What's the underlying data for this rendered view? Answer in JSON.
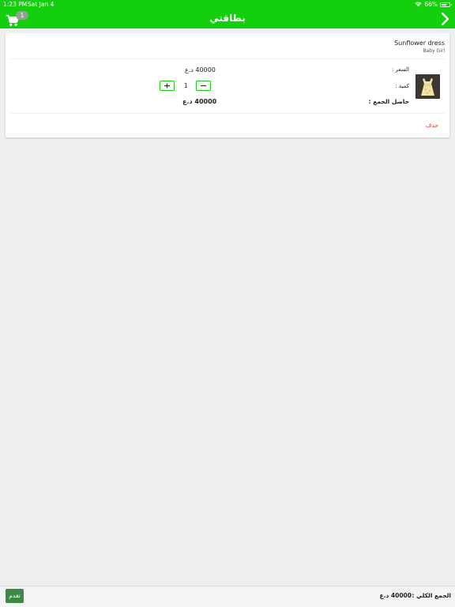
{
  "status_bar": {
    "time": "1:23 PM",
    "date": "Sat Jan 4",
    "battery": "66%",
    "battery_level": 0.66,
    "icons": [
      "wifi-icon",
      "battery-icon"
    ]
  },
  "nav": {
    "title": "بطاقتي",
    "cart_count": "1",
    "icons": [
      "cart-icon",
      "chevron-right-icon"
    ]
  },
  "cart_item": {
    "name": "Sunflower dress",
    "category": "Baby Girl",
    "price_label": "السعر :",
    "price_value": "40000 د.ع",
    "quantity_label": "كمية :",
    "quantity_value": "1",
    "subtotal_label": "حاصل الجمع :",
    "subtotal_value": "40000 د.ع",
    "delete_label": "حذف"
  },
  "footer": {
    "total_label": "الجمع الكلي :",
    "total_value": "40000 د.ع",
    "proceed_label": "تقدم"
  },
  "colors": {
    "brand_green": "#14cf0e",
    "proceed_button": "#3d8a44",
    "delete_red": "#e23a2e",
    "background": "#efefef"
  }
}
